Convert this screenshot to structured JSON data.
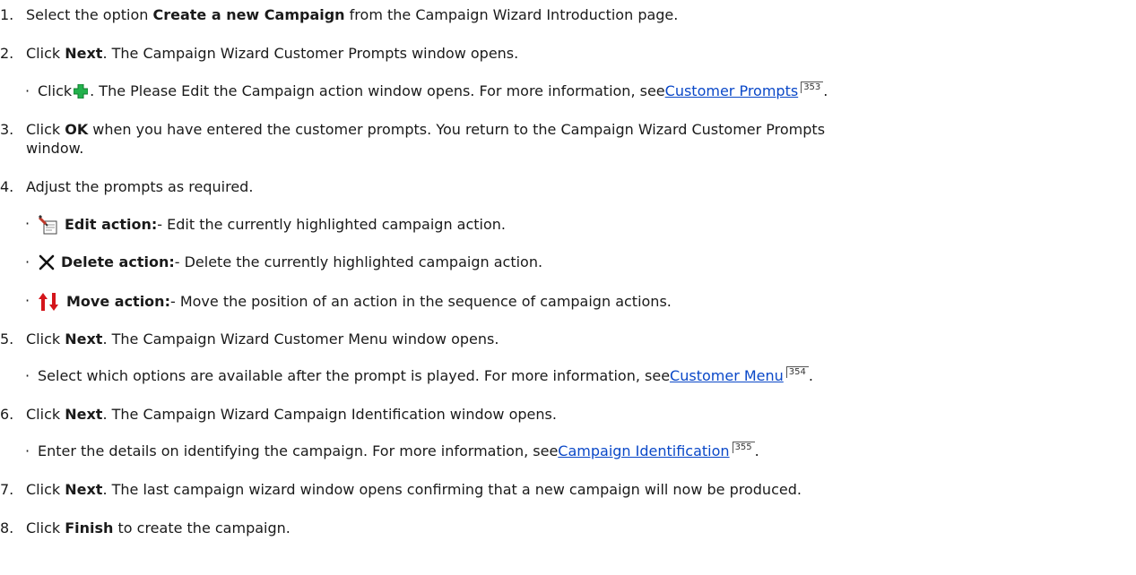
{
  "steps": [
    {
      "n": "1.",
      "pre": "Select the option ",
      "bold": "Create a new Campaign",
      "post": " from the Campaign Wizard Introduction page."
    },
    {
      "n": "2.",
      "pre": "Click ",
      "bold": "Next",
      "post": ". The Campaign Wizard Customer Prompts window opens."
    },
    {
      "n": "3.",
      "pre": "Click ",
      "bold": "OK",
      "post": " when you have entered the customer prompts. You return to the Campaign Wizard Customer Prompts",
      "cont": "window."
    },
    {
      "n": "4.",
      "text": "Adjust the prompts as required."
    },
    {
      "n": "5.",
      "pre": "Click ",
      "bold": "Next",
      "post": ". The Campaign Wizard Customer Menu window opens."
    },
    {
      "n": "6.",
      "pre": "Click ",
      "bold": "Next",
      "post": ". The Campaign Wizard Campaign Identification window opens."
    },
    {
      "n": "7.",
      "pre": "Click ",
      "bold": "Next",
      "post": ". The last campaign wizard window opens confirming that a new campaign will now be produced."
    },
    {
      "n": "8.",
      "pre": "Click ",
      "bold": "Finish",
      "post": " to create the campaign."
    }
  ],
  "bullet": "·",
  "sub_add": {
    "pre": "Click ",
    "icon": "green-plus-icon",
    "post": ". The Please Edit the Campaign action window opens. For more information, see ",
    "link": "Customer Prompts",
    "ref": "353",
    "end": "."
  },
  "sub_edit": {
    "icon": "edit-document-icon",
    "bold": "Edit action:",
    "post": " - Edit the currently highlighted campaign action."
  },
  "sub_delete": {
    "icon": "delete-x-icon",
    "bold": "Delete action:",
    "post": " - Delete the currently highlighted campaign action."
  },
  "sub_move": {
    "icon": "move-up-down-arrows-icon",
    "bold": "Move action:",
    "post": " - Move the position of an action in the sequence of campaign actions."
  },
  "sub_menu": {
    "text": "Select which options are available after the prompt is played. For more information, see ",
    "link": "Customer Menu",
    "ref": "354",
    "end": "."
  },
  "sub_ident": {
    "text": "Enter the details on identifying the campaign. For more information, see ",
    "link": "Campaign Identification",
    "ref": "355",
    "end": "."
  },
  "colors": {
    "link": "#0a48c8",
    "plus": "#22b14c",
    "arrows": "#d4151b"
  }
}
